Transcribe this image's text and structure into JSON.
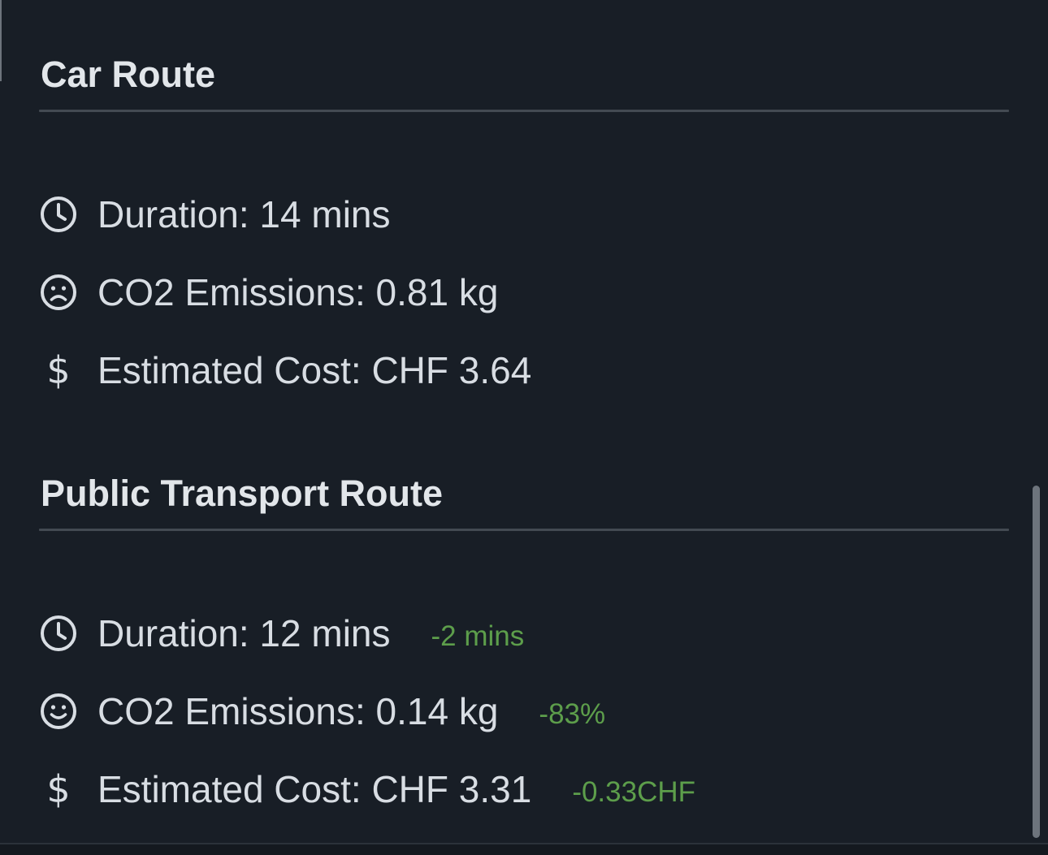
{
  "car_route": {
    "title": "Car Route",
    "duration": {
      "icon": "clock-icon",
      "text": "Duration: 14 mins"
    },
    "emissions": {
      "icon": "frown-face-icon",
      "text": "CO2 Emissions: 0.81 kg"
    },
    "cost": {
      "icon": "dollar-icon",
      "symbol": "$",
      "text": "Estimated Cost: CHF 3.64"
    }
  },
  "public_transport_route": {
    "title": "Public Transport Route",
    "duration": {
      "icon": "clock-icon",
      "text": "Duration: 12 mins",
      "delta": "-2 mins"
    },
    "emissions": {
      "icon": "smile-face-icon",
      "text": "CO2 Emissions: 0.14 kg",
      "delta": "-83%"
    },
    "cost": {
      "icon": "dollar-icon",
      "symbol": "$",
      "text": "Estimated Cost: CHF 3.31",
      "delta": "-0.33CHF"
    }
  },
  "colors": {
    "background": "#181e26",
    "text": "#d8dde3",
    "delta_positive": "#5d9e4b",
    "divider": "#434a52"
  }
}
